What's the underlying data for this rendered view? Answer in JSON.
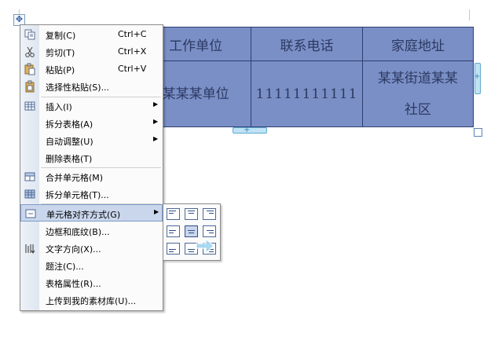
{
  "table": {
    "rows": [
      [
        "工作单位",
        "联系电话",
        "家庭地址"
      ],
      [
        "某某某单位",
        "11111111111",
        "某某街道某某社区"
      ]
    ],
    "cell_color": "#7a8fc6",
    "move_handle_icon": "move-cross-icon"
  },
  "context_menu": {
    "items": [
      {
        "label": "复制(C)",
        "shortcut": "Ctrl+C",
        "icon": "copy-icon"
      },
      {
        "label": "剪切(T)",
        "shortcut": "Ctrl+X",
        "icon": "cut-icon"
      },
      {
        "label": "粘贴(P)",
        "shortcut": "Ctrl+V",
        "icon": "paste-icon"
      },
      {
        "label": "选择性粘贴(S)...",
        "icon": "paste-special-icon"
      },
      {
        "label": "插入(I)",
        "submenu": true,
        "icon": "insert-table-icon"
      },
      {
        "label": "拆分表格(A)",
        "submenu": true
      },
      {
        "label": "自动调整(U)",
        "submenu": true
      },
      {
        "label": "删除表格(T)"
      },
      {
        "label": "合并单元格(M)",
        "icon": "merge-cells-icon"
      },
      {
        "label": "拆分单元格(T)...",
        "icon": "split-cells-icon"
      },
      {
        "label": "单元格对齐方式(G)",
        "submenu": true,
        "highlighted": true,
        "icon": "cell-align-icon"
      },
      {
        "label": "边框和底纹(B)..."
      },
      {
        "label": "文字方向(X)...",
        "icon": "text-direction-icon"
      },
      {
        "label": "题注(C)..."
      },
      {
        "label": "表格属性(R)..."
      },
      {
        "label": "上传到我的素材库(U)..."
      }
    ],
    "highlight_color": "#c9d6ec"
  },
  "alignment_submenu": {
    "options": [
      [
        "top-left",
        "top-center",
        "top-right"
      ],
      [
        "middle-left",
        "middle-center",
        "middle-right"
      ],
      [
        "bottom-left",
        "bottom-center",
        "bottom-right"
      ]
    ],
    "selected": "middle-center"
  }
}
